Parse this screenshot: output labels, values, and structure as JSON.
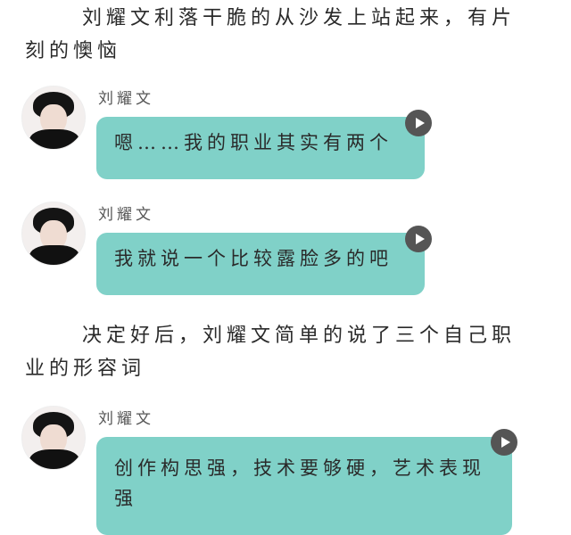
{
  "narration": [
    "刘耀文利落干脆的从沙发上站起来，有片刻的懊恼",
    "决定好后，刘耀文简单的说了三个自己职业的形容词"
  ],
  "messages": [
    {
      "name": "刘耀文",
      "text": "嗯……我的职业其实有两个"
    },
    {
      "name": "刘耀文",
      "text": "我就说一个比较露脸多的吧"
    },
    {
      "name": "刘耀文",
      "text": "创作构思强，技术要够硬，艺术表现强"
    }
  ],
  "colors": {
    "bubble": "#80d1c8",
    "play_button": "#555555"
  },
  "icons": {
    "play": "play-icon"
  }
}
